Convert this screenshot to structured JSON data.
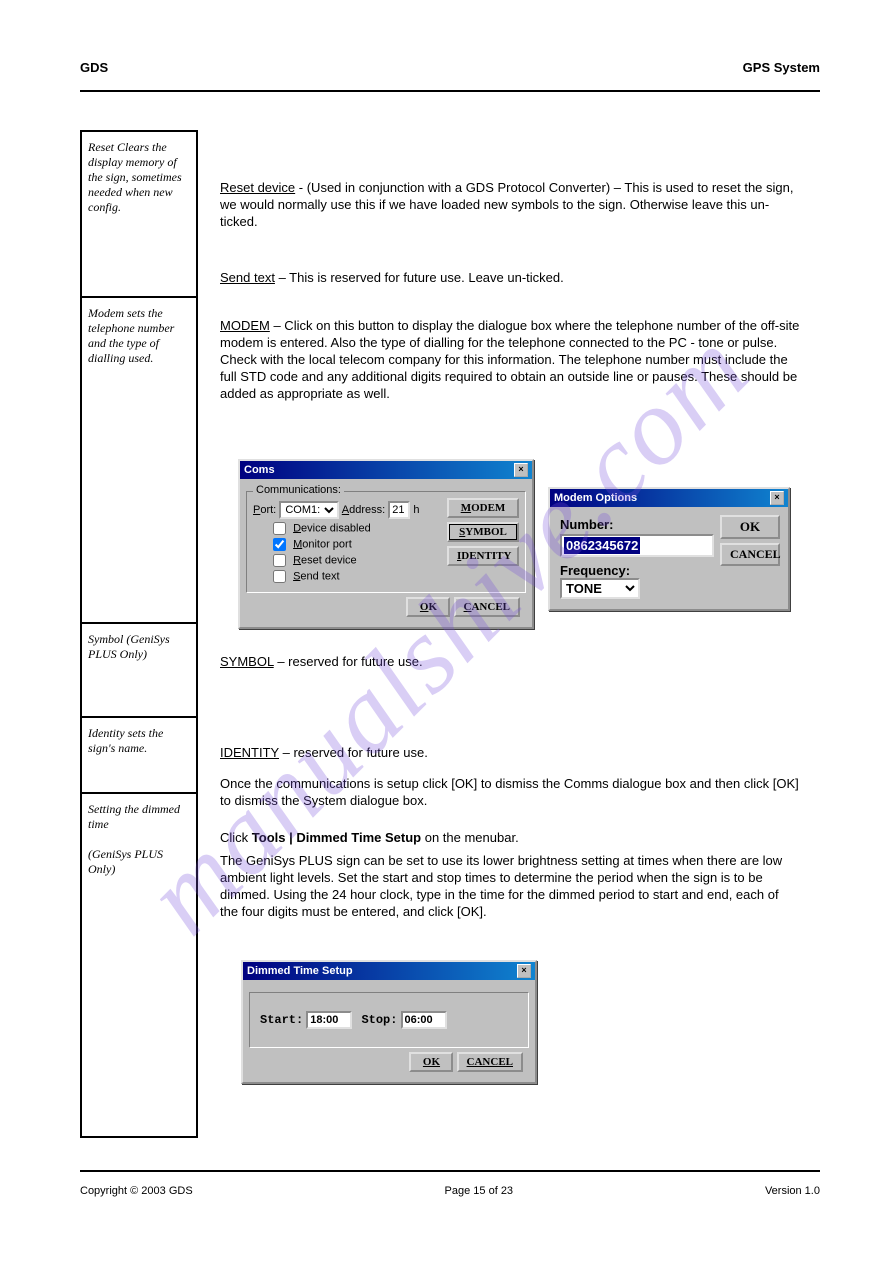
{
  "watermark": "manualshive.com",
  "header": {
    "left": "GDS",
    "right": "GPS System"
  },
  "left": {
    "c1": "Reset Clears the display memory of the sign, sometimes needed when new config.",
    "c2": "Modem sets the telephone number and the type of dialling used.",
    "c3a": "Symbol",
    "c3b": "(GeniSys PLUS Only)",
    "c4": "Identity sets the sign's name.",
    "c5a": "Setting the dimmed time",
    "c5b": "(GeniSys PLUS Only)"
  },
  "body": {
    "p1a": "Reset device",
    "p1b": "- (Used in conjunction with a GDS Protocol Converter) – This is used to reset the sign, we would normally use this if we have loaded new symbols to the sign. Otherwise leave this un-ticked.",
    "p2a": "Send text",
    "p2b": "– This is reserved for future use. Leave un-ticked.",
    "p3a": "MODEM",
    "p3b": "– Click on this button to display the dialogue box where the telephone number of the off-site modem is entered. Also the type of dialling for the telephone connected to the PC - tone or pulse. Check with the local telecom company for this information. The telephone number must include the full STD code and any additional digits required to obtain an outside line or pauses. These should be added as appropriate as well.",
    "p4a": "SYMBOL",
    "p4b": "– reserved for future use.",
    "p5a": "IDENTITY",
    "p5b": "– reserved for future use.",
    "p6": "Once the communications is setup click [OK] to dismiss the Comms dialogue box and then click [OK] to dismiss the System dialogue box.",
    "p7a": "Click",
    "p7b": "Tools | Dimmed Time Setup",
    "p7c": "on the menubar.",
    "p8": "The GeniSys PLUS sign can be set to use its lower brightness setting at times when there are low ambient light levels. Set the start and stop times to determine the period when the sign is to be dimmed. Using the 24 hour clock, type in the time for the dimmed period to start and end, each of the four digits must be entered, and click [OK]."
  },
  "dlg_coms": {
    "title": "Coms",
    "group_label": "Communications:",
    "port_label": "Port:",
    "port_value": "COM1:",
    "addr_label": "Address:",
    "addr_value": "21",
    "addr_suffix": "h",
    "chk1": "Device disabled",
    "chk2": "Monitor port",
    "chk2_checked": true,
    "chk3": "Reset device",
    "chk4": "Send text",
    "btn_modem": "MODEM",
    "btn_symbol": "SYMBOL",
    "btn_identity": "IDENTITY",
    "btn_ok": "OK",
    "btn_cancel": "CANCEL"
  },
  "dlg_modem": {
    "title": "Modem Options",
    "number_label": "Number:",
    "number_value": "0862345672",
    "freq_label": "Frequency:",
    "freq_value": "TONE",
    "btn_ok": "OK",
    "btn_cancel": "CANCEL"
  },
  "dlg_dim": {
    "title": "Dimmed Time Setup",
    "start_label": "Start:",
    "start_value": "18:00",
    "stop_label": "Stop:",
    "stop_value": "06:00",
    "btn_ok": "OK",
    "btn_cancel": "CANCEL"
  },
  "footer": {
    "left": "Copyright © 2003 GDS",
    "center": "Page 15 of 23",
    "right": "Version 1.0"
  }
}
